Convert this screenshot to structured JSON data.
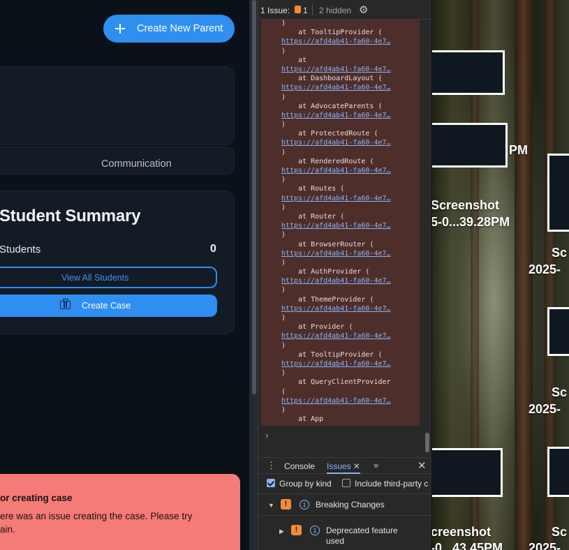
{
  "app": {
    "create_parent_label": "Create New Parent",
    "tab_communication": "Communication",
    "summary": {
      "title": "Student Summary",
      "students_label": "Students",
      "students_count": "0",
      "view_all_label": "View All Students",
      "create_case_label": "Create Case"
    },
    "toast": {
      "title": "or creating case",
      "message_line1": "ere was an issue creating the case. Please try",
      "message_line2": "ain."
    }
  },
  "devtools": {
    "issues_label": "1 Issue:",
    "issues_count": "1",
    "hidden_label": "2 hidden",
    "stack": [
      {
        "t": "text",
        "v": ")"
      },
      {
        "t": "text",
        "v": "    at TooltipProvider ("
      },
      {
        "t": "link",
        "v": "https://afd4ab41-fa60-4e7…"
      },
      {
        "t": "text",
        "v": ")"
      },
      {
        "t": "text",
        "v": "    at"
      },
      {
        "t": "link",
        "v": "https://afd4ab41-fa60-4e7…"
      },
      {
        "t": "text",
        "v": "    at DashboardLayout ("
      },
      {
        "t": "link",
        "v": "https://afd4ab41-fa60-4e7…"
      },
      {
        "t": "text",
        "v": ")"
      },
      {
        "t": "text",
        "v": "    at AdvocateParents ("
      },
      {
        "t": "link",
        "v": "https://afd4ab41-fa60-4e7…"
      },
      {
        "t": "text",
        "v": ")"
      },
      {
        "t": "text",
        "v": "    at ProtectedRoute ("
      },
      {
        "t": "link",
        "v": "https://afd4ab41-fa60-4e7…"
      },
      {
        "t": "text",
        "v": ")"
      },
      {
        "t": "text",
        "v": "    at RenderedRoute ("
      },
      {
        "t": "link",
        "v": "https://afd4ab41-fa60-4e7…"
      },
      {
        "t": "text",
        "v": ")"
      },
      {
        "t": "text",
        "v": "    at Routes ("
      },
      {
        "t": "link",
        "v": "https://afd4ab41-fa60-4e7…"
      },
      {
        "t": "text",
        "v": ")"
      },
      {
        "t": "text",
        "v": "    at Router ("
      },
      {
        "t": "link",
        "v": "https://afd4ab41-fa60-4e7…"
      },
      {
        "t": "text",
        "v": ")"
      },
      {
        "t": "text",
        "v": "    at BrowserRouter ("
      },
      {
        "t": "link",
        "v": "https://afd4ab41-fa60-4e7…"
      },
      {
        "t": "text",
        "v": ")"
      },
      {
        "t": "text",
        "v": "    at AuthProvider ("
      },
      {
        "t": "link",
        "v": "https://afd4ab41-fa60-4e7…"
      },
      {
        "t": "text",
        "v": ")"
      },
      {
        "t": "text",
        "v": "    at ThemeProvider ("
      },
      {
        "t": "link",
        "v": "https://afd4ab41-fa60-4e7…"
      },
      {
        "t": "text",
        "v": ")"
      },
      {
        "t": "text",
        "v": "    at Provider ("
      },
      {
        "t": "link",
        "v": "https://afd4ab41-fa60-4e7…"
      },
      {
        "t": "text",
        "v": ")"
      },
      {
        "t": "text",
        "v": "    at TooltipProvider ("
      },
      {
        "t": "link",
        "v": "https://afd4ab41-fa60-4e7…"
      },
      {
        "t": "text",
        "v": ")"
      },
      {
        "t": "text",
        "v": "    at QueryClientProvider"
      },
      {
        "t": "text",
        "v": "("
      },
      {
        "t": "link",
        "v": "https://afd4ab41-fa60-4e7…"
      },
      {
        "t": "text",
        "v": ")"
      },
      {
        "t": "text",
        "v": "    at App"
      }
    ],
    "prompt_symbol": "›",
    "tab_console": "Console",
    "tab_issues": "Issues",
    "group_by_kind": "Group by kind",
    "include_third_party": "Include third-party c",
    "breaking_changes": "Breaking Changes",
    "breaking_count": "1",
    "deprecated_line1": "Deprecated feature",
    "deprecated_line2": "used",
    "deprecated_count": "1"
  },
  "desktop": {
    "labels": [
      {
        "id": "l1",
        "text": "PM"
      },
      {
        "id": "l2",
        "text": "Screenshot"
      },
      {
        "id": "l3",
        "text": "5-0...39.28PM"
      },
      {
        "id": "l4",
        "text": "Sc"
      },
      {
        "id": "l5",
        "text": "2025-"
      },
      {
        "id": "l6",
        "text": "Sc"
      },
      {
        "id": "l7",
        "text": "2025-"
      },
      {
        "id": "l8",
        "text": "creenshot"
      },
      {
        "id": "l9",
        "text": "-0...43.45PM"
      },
      {
        "id": "l10",
        "text": "Sc"
      },
      {
        "id": "l11",
        "text": "2025-"
      }
    ]
  }
}
